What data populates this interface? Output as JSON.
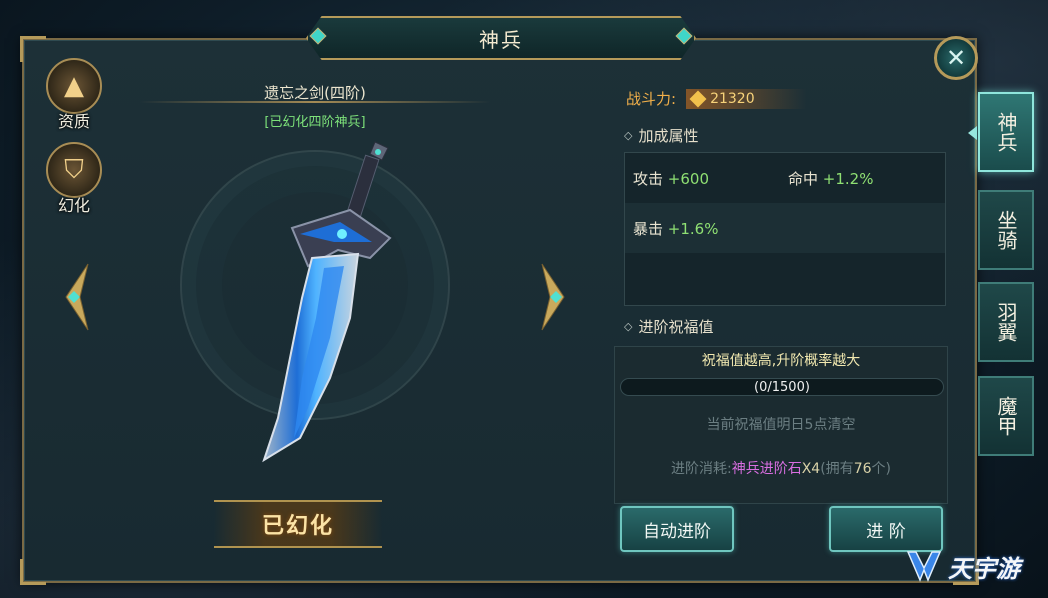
{
  "window": {
    "title": "神兵",
    "close_icon": "close-icon"
  },
  "left_icons": [
    {
      "label": "资质",
      "icon": "book-icon"
    },
    {
      "label": "幻化",
      "icon": "shield-icon"
    }
  ],
  "weapon": {
    "name": "遗忘之剑(四阶)",
    "subtitle": "[已幻化四阶神兵]",
    "action_label": "已幻化"
  },
  "power": {
    "label": "战斗力:",
    "value": "21320"
  },
  "attributes": {
    "title": "加成属性",
    "items": [
      {
        "name": "攻击",
        "value": "+600"
      },
      {
        "name": "命中",
        "value": "+1.2%"
      },
      {
        "name": "暴击",
        "value": "+1.6%"
      }
    ]
  },
  "blessing": {
    "title": "进阶祝福值",
    "hint": "祝福值越高,升阶概率越大",
    "progress_text": "(0/1500)",
    "progress_value": 0,
    "progress_max": 1500,
    "note": "当前祝福值明日5点清空",
    "cost_prefix": "进阶消耗:",
    "cost_item": "神兵进阶石",
    "cost_qty": "X4",
    "own_prefix": "(拥有",
    "own_count": "76",
    "own_suffix": "个)"
  },
  "buttons": {
    "auto": "自动进阶",
    "advance": "进 阶"
  },
  "tabs": [
    {
      "label": "神兵",
      "active": true
    },
    {
      "label": "坐骑",
      "active": false
    },
    {
      "label": "羽翼",
      "active": false
    },
    {
      "label": "魔甲",
      "active": false
    }
  ],
  "watermark": {
    "text": "天宇游"
  },
  "colors": {
    "accent": "#b59a5a",
    "teal": "#3fd6c8",
    "green_value": "#8fe073",
    "item_purple": "#d86ee0"
  }
}
